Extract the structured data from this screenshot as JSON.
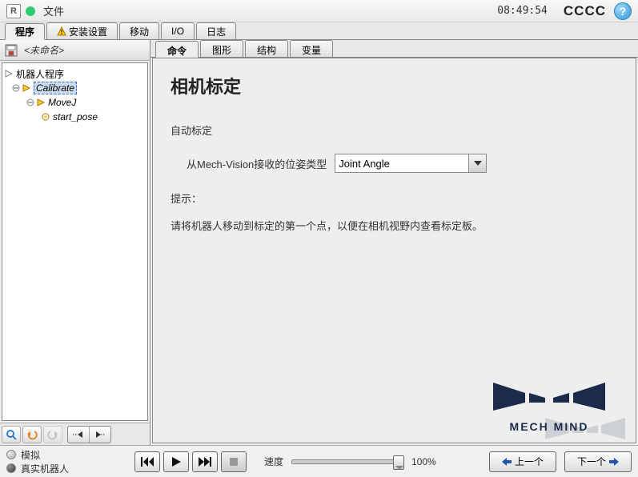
{
  "titlebar": {
    "file_menu": "文件",
    "time": "08:49:54",
    "cccc": "CCCC"
  },
  "main_tabs": [
    "程序",
    "安装设置",
    "移动",
    "I/O",
    "日志"
  ],
  "filename": "<未命名>",
  "tree": {
    "root": "机器人程序",
    "node1": "Calibrate",
    "node2": "MoveJ",
    "node3": "start_pose"
  },
  "sub_tabs": [
    "命令",
    "图形",
    "结构",
    "变量"
  ],
  "panel": {
    "title": "相机标定",
    "auto_label": "自动标定",
    "pose_label": "从Mech-Vision接收的位姿类型",
    "pose_value": "Joint Angle",
    "hint_label": "提示：",
    "hint_text": "请将机器人移动到标定的第一个点，以便在相机视野内查看标定板。"
  },
  "brand": "MECH MIND",
  "bottom": {
    "sim": "模拟",
    "real": "真实机器人",
    "speed_label": "速度",
    "speed_value": "100%",
    "prev": "上一个",
    "next": "下一个"
  }
}
